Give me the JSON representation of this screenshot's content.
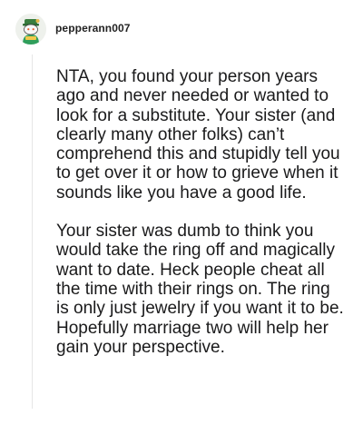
{
  "comment": {
    "username": "pepperann007",
    "avatar_icon": "snoo-avatar-icon",
    "paragraphs": [
      "NTA, you found your person years ago and never needed or wanted to look for a substitute. Your sister (and clearly many other folks) can’t comprehend this and stupidly tell you to get over it or how to grieve when it sounds like you have a good life.",
      "Your sister was dumb to think you would take the ring off and magically want to date. Heck people cheat all the time with their rings on. The ring is only just jewelry if you want it to be. Hopefully marriage two will help her gain your perspective."
    ]
  }
}
